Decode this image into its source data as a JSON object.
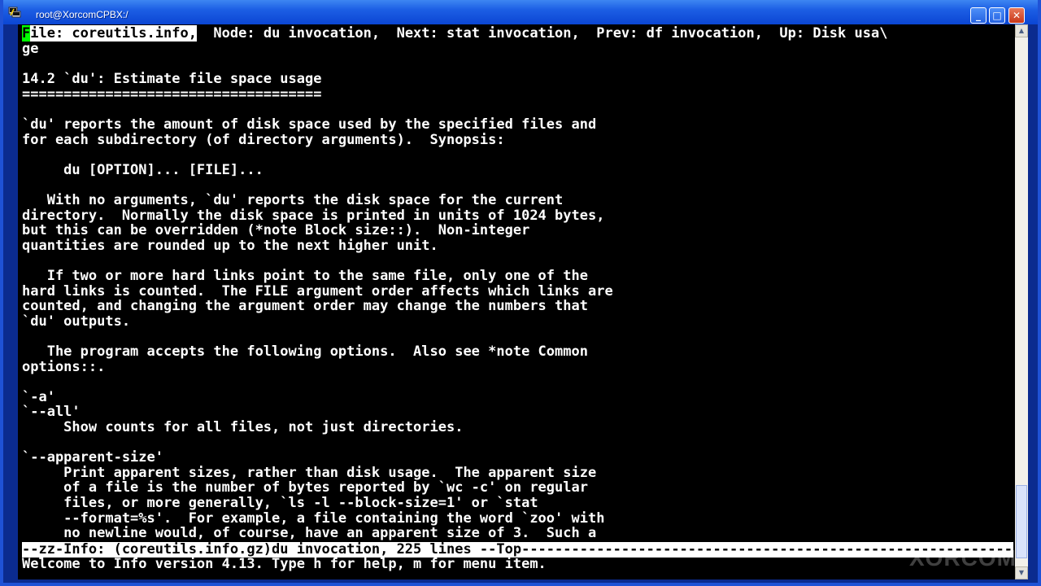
{
  "window": {
    "title": "root@XorcomCPBX:/",
    "buttons": {
      "minimize": "_",
      "maximize": "□",
      "close": "✕"
    }
  },
  "terminal": {
    "header_cursor_char": "F",
    "header_file": "ile: coreutils.info,",
    "header_rest": "  Node: du invocation,  Next: stat invocation,  Prev: df invocation,  Up: Disk usa\\",
    "lines": [
      "ge",
      "",
      "14.2 `du': Estimate file space usage",
      "====================================",
      "",
      "`du' reports the amount of disk space used by the specified files and",
      "for each subdirectory (of directory arguments).  Synopsis:",
      "",
      "     du [OPTION]... [FILE]...",
      "",
      "   With no arguments, `du' reports the disk space for the current",
      "directory.  Normally the disk space is printed in units of 1024 bytes,",
      "but this can be overridden (*note Block size::).  Non-integer",
      "quantities are rounded up to the next higher unit.",
      "",
      "   If two or more hard links point to the same file, only one of the",
      "hard links is counted.  The FILE argument order affects which links are",
      "counted, and changing the argument order may change the numbers that",
      "`du' outputs.",
      "",
      "   The program accepts the following options.  Also see *note Common",
      "options::.",
      "",
      "`-a'",
      "`--all'",
      "     Show counts for all files, not just directories.",
      "",
      "`--apparent-size'",
      "     Print apparent sizes, rather than disk usage.  The apparent size",
      "     of a file is the number of bytes reported by `wc -c' on regular",
      "     files, or more generally, `ls -l --block-size=1' or `stat",
      "     --format=%s'.  For example, a file containing the word `zoo' with",
      "     no newline would, of course, have an apparent size of 3.  Such a"
    ],
    "mode_line": "--zz-Info: (coreutils.info.gz)du invocation, 225 lines --Top------------------------------------------------------------------------",
    "echo_area": "Welcome to Info version 4.13. Type h for help, m for menu item."
  },
  "watermark": "XORCOM"
}
